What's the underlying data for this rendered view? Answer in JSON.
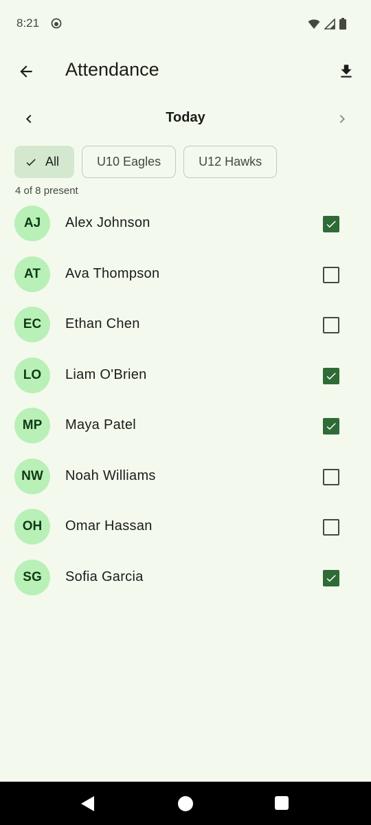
{
  "status_bar": {
    "time": "8:21"
  },
  "app_bar": {
    "title": "Attendance"
  },
  "date_nav": {
    "label": "Today"
  },
  "filters": {
    "chips": [
      {
        "label": "All",
        "selected": true
      },
      {
        "label": "U10 Eagles",
        "selected": false
      },
      {
        "label": "U12 Hawks",
        "selected": false
      }
    ]
  },
  "summary": {
    "count_text": "4 of 8 present"
  },
  "players": [
    {
      "initials": "AJ",
      "name": "Alex Johnson",
      "present": true
    },
    {
      "initials": "AT",
      "name": "Ava Thompson",
      "present": false
    },
    {
      "initials": "EC",
      "name": "Ethan Chen",
      "present": false
    },
    {
      "initials": "LO",
      "name": "Liam O'Brien",
      "present": true
    },
    {
      "initials": "MP",
      "name": "Maya Patel",
      "present": true
    },
    {
      "initials": "NW",
      "name": "Noah Williams",
      "present": false
    },
    {
      "initials": "OH",
      "name": "Omar Hassan",
      "present": false
    },
    {
      "initials": "SG",
      "name": "Sofia Garcia",
      "present": true
    }
  ],
  "colors": {
    "background": "#f4f9ee",
    "avatar": "#b9f0b7",
    "checkbox_checked": "#2e6b36",
    "chip_selected": "#d3e8cf"
  },
  "icons": {
    "back": "arrow-left-icon",
    "download": "download-icon",
    "prev": "chevron-left-icon",
    "next": "chevron-right-icon",
    "check": "check-icon"
  }
}
